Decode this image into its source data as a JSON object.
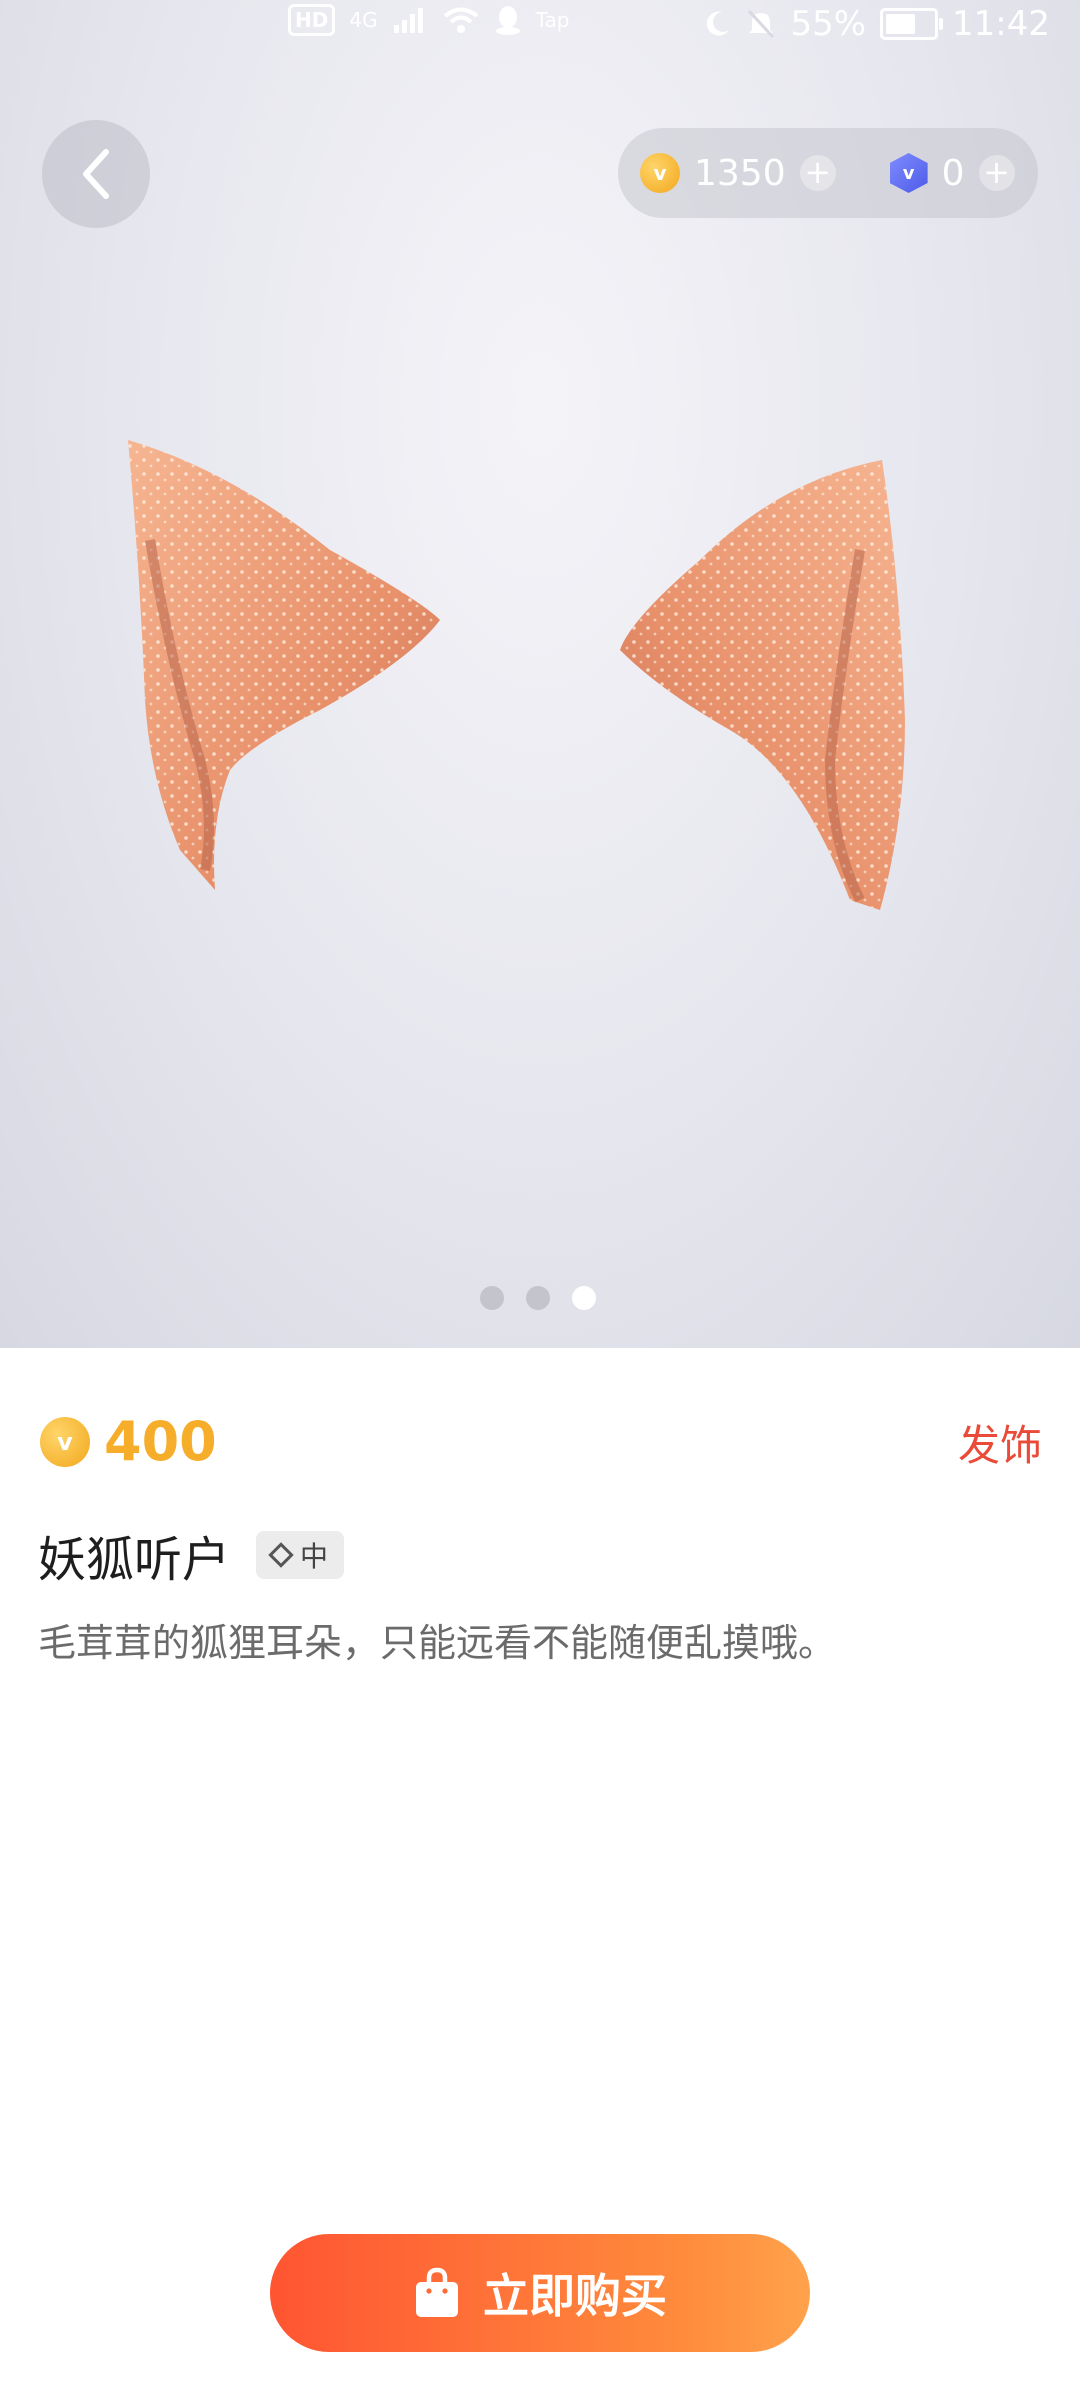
{
  "status_bar": {
    "left_badges": [
      "HD",
      "4G",
      "Tap"
    ],
    "battery": "55%",
    "battery_level": 0.55,
    "time": "11:42"
  },
  "header": {
    "back_icon": "chevron-left-icon",
    "coins": "1350",
    "gems": "0"
  },
  "carousel": {
    "page_count": 3,
    "active_index": 2
  },
  "item": {
    "price": "400",
    "category": "发饰",
    "name": "妖狐听户",
    "rarity": "中",
    "description": "毛茸茸的狐狸耳朵，只能远看不能随便乱摸哦。"
  },
  "footer": {
    "buy_label": "立即购买",
    "buy_icon": "shopping-bag-icon"
  },
  "colors": {
    "accent": "#ff5532",
    "accent_end": "#ffa24c",
    "price": "#f6ad2a",
    "category": "#ea4b38",
    "ear": "#f0a07a"
  }
}
